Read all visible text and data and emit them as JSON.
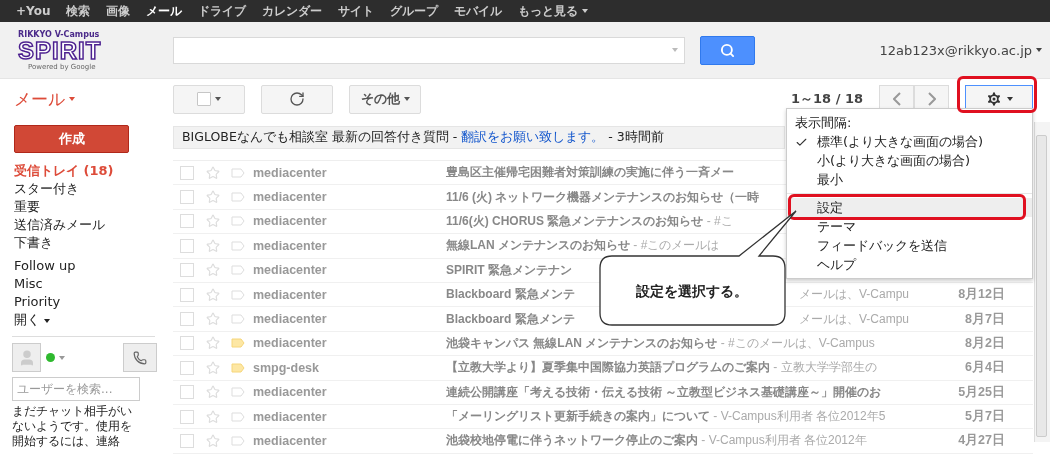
{
  "top_nav": [
    {
      "label": "+You",
      "selected": false
    },
    {
      "label": "検索",
      "selected": false
    },
    {
      "label": "画像",
      "selected": false
    },
    {
      "label": "メール",
      "selected": true
    },
    {
      "label": "ドライブ",
      "selected": false
    },
    {
      "label": "カレンダー",
      "selected": false
    },
    {
      "label": "サイト",
      "selected": false
    },
    {
      "label": "グループ",
      "selected": false
    },
    {
      "label": "モバイル",
      "selected": false
    },
    {
      "label": "もっと見る",
      "selected": false
    }
  ],
  "logo": {
    "top": "RIKKYO V-Campus",
    "main": "SPIRIT",
    "sub": "Powered by Google"
  },
  "account": "12ab123x@rikkyo.ac.jp",
  "toolbar": {
    "mail_menu": "メール",
    "more": "その他",
    "pagination": "1～18 / 18"
  },
  "compose": "作成",
  "folders": [
    {
      "label": "受信トレイ (18)",
      "selected": true
    },
    {
      "label": "スター付き",
      "selected": false
    },
    {
      "label": "重要",
      "selected": false
    },
    {
      "label": "送信済みメール",
      "selected": false
    },
    {
      "label": "下書き",
      "selected": false
    }
  ],
  "labels": [
    "Follow up",
    "Misc",
    "Priority"
  ],
  "labels_more": "開く",
  "chat": {
    "search_placeholder": "ユーザーを検索...",
    "message": "まだチャット相手がいないようです。使用を開始するには、連絡"
  },
  "ad": {
    "text": "BIGLOBEなんでも相談室 最新の回答付き質問 - ",
    "link": "翻訳をお願い致します。",
    "time": " - 3時間前"
  },
  "messages": [
    {
      "sender": "mediacenter",
      "subject": "豊島区主催帰宅困難者対策訓練の実施に伴う一斉メー",
      "checked": false,
      "marked": false
    },
    {
      "sender": "mediacenter",
      "subject": "11/6 (火) ネットワーク機器メンテナンスのお知らせ（一時",
      "checked": false,
      "marked": false
    },
    {
      "sender": "mediacenter",
      "subject": "11/6(火) CHORUS 緊急メンテナンスのお知らせ",
      "snippet": " - #こ",
      "checked": false,
      "marked": false
    },
    {
      "sender": "mediacenter",
      "subject": "無線LAN メンテナンスのお知らせ",
      "snippet": " - #このメールは",
      "checked": false,
      "marked": false
    },
    {
      "sender": "mediacenter",
      "subject": "SPIRIT 緊急メンテナン",
      "checked": false,
      "marked": false
    },
    {
      "sender": "mediacenter",
      "subject": "Blackboard 緊急メンテ",
      "tail": "メールは、V-Campu",
      "date": "8月12日",
      "checked": false,
      "marked": false
    },
    {
      "sender": "mediacenter",
      "subject": "Blackboard 緊急メンテ",
      "tail": "メールは、V-Campu",
      "date": "8月7日",
      "checked": false,
      "marked": false
    },
    {
      "sender": "mediacenter",
      "subject": "池袋キャンパス 無線LAN メンテナンスのお知らせ",
      "snippet": " - #このメールは、V-Campus",
      "date": "8月2日",
      "checked": false,
      "marked": true
    },
    {
      "sender": "smpg-desk",
      "subject": "【立教大学より】夏季集中国際協力英語プログラムのご案内",
      "snippet": " - 立教大学学部生の",
      "date": "6月4日",
      "checked": false,
      "marked": true
    },
    {
      "sender": "mediacenter",
      "subject": "連続公開講座「考える技術・伝える技術 ～立教型ビジネス基礎講座～」開催のお",
      "date": "5月25日",
      "checked": false,
      "marked": false
    },
    {
      "sender": "mediacenter",
      "subject": "「メーリングリスト更新手続きの案内」について",
      "snippet": " - V-Campus利用者 各位2012年5",
      "date": "5月7日",
      "checked": false,
      "marked": false
    },
    {
      "sender": "mediacenter",
      "subject": "池袋校地停電に伴うネットワーク停止のご案内",
      "snippet": " - V-Campus利用者 各位2012年",
      "date": "4月27日",
      "checked": false,
      "marked": false
    }
  ],
  "settings_menu": {
    "heading": "表示間隔:",
    "density": [
      {
        "label": "標準(より大きな画面の場合)",
        "checked": true
      },
      {
        "label": "小(より大きな画面の場合)",
        "checked": false
      },
      {
        "label": "最小",
        "checked": false
      }
    ],
    "actions": [
      {
        "label": "設定",
        "selected": true
      },
      {
        "label": "テーマ",
        "selected": false
      },
      {
        "label": "フィードバックを送信",
        "selected": false
      },
      {
        "label": "ヘルプ",
        "selected": false
      }
    ]
  },
  "callout": "設定を選択する。"
}
